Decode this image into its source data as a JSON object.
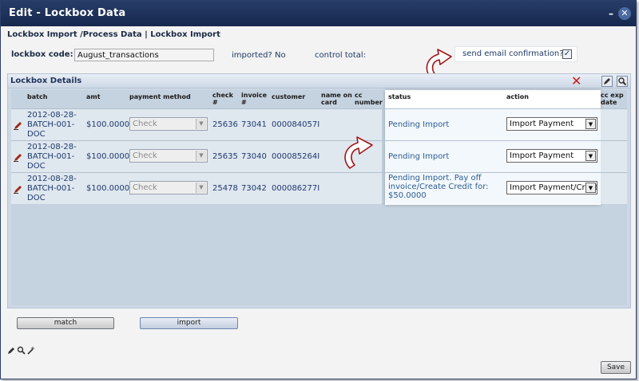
{
  "window": {
    "title": "Edit - Lockbox Data",
    "minimize": "–",
    "close": "✕"
  },
  "breadcrumb": "Lockbox Import /Process Data | Lockbox Import",
  "form": {
    "lockbox_code_label": "lockbox code:",
    "lockbox_code_value": "August_transactions",
    "imported_label": "imported?",
    "imported_value": "No",
    "control_total_label": "control total:",
    "send_email_label": "send email confirmation?",
    "send_email_checked": "✓"
  },
  "details": {
    "title": "Lockbox Details",
    "delete_icon": "✕",
    "columns": {
      "batch": "batch",
      "amt": "amt",
      "payment_method": "payment method",
      "check_no": "check #",
      "invoice_no": "invoice #",
      "customer": "customer",
      "name_on_card": "name on card",
      "cc_number": "cc number",
      "status": "status",
      "action": "action",
      "cc_exp_date": "cc exp date"
    },
    "rows": [
      {
        "batch": "2012-08-28-BATCH-001-DOC",
        "amt": "$100.0000",
        "payment_method": "Check",
        "check": "25636",
        "invoice": "73041",
        "customer": "000084057I",
        "status": "Pending Import",
        "action": "Import Payment"
      },
      {
        "batch": "2012-08-28-BATCH-001-DOC",
        "amt": "$100.0000",
        "payment_method": "Check",
        "check": "25635",
        "invoice": "73040",
        "customer": "000085264I",
        "status": "Pending Import",
        "action": "Import Payment"
      },
      {
        "batch": "2012-08-28-BATCH-001-DOC",
        "amt": "$100.0000",
        "payment_method": "Check",
        "check": "25478",
        "invoice": "73042",
        "customer": "000086277I",
        "status": "Pending Import. Pay off invoice/Create Credit for: $50.0000",
        "action": "Import Payment/Create Credit"
      }
    ]
  },
  "buttons": {
    "match": "match",
    "import": "import",
    "save": "Save"
  },
  "colors": {
    "title_bar": "#1c2f57",
    "panel": "#cdd8e4",
    "link_text": "#1e3a6e",
    "status_text": "#2a5d95",
    "delete_red": "#d01818"
  },
  "icons": [
    "pencil-icon",
    "magnifier-icon",
    "wand-icon",
    "delete-x-icon",
    "arrow-callout-icon"
  ]
}
